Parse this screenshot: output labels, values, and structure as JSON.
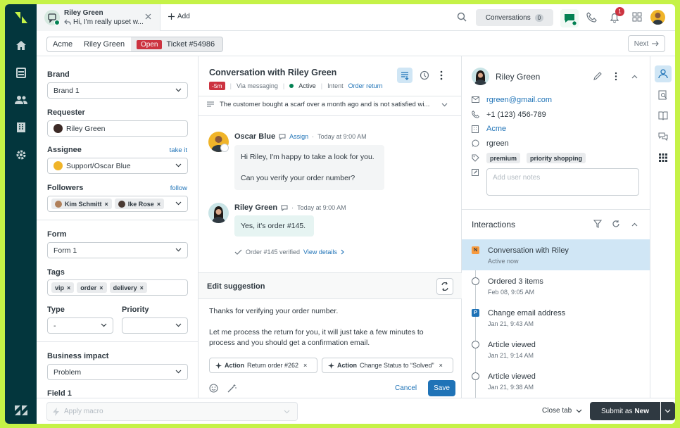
{
  "topbar": {
    "tab_user": "Riley Green",
    "tab_preview": "Hi, I'm really upset w...",
    "add_label": "Add",
    "conversations_label": "Conversations",
    "conversations_count": "0",
    "notification_count": "1"
  },
  "breadcrumb": {
    "org": "Acme",
    "requester": "Riley Green",
    "status": "Open",
    "ticket": "Ticket #54986",
    "next_label": "Next"
  },
  "left": {
    "brand_label": "Brand",
    "brand_value": "Brand 1",
    "requester_label": "Requester",
    "requester_value": "Riley Green",
    "assignee_label": "Assignee",
    "assignee_link": "take it",
    "assignee_value": "Support/Oscar Blue",
    "followers_label": "Followers",
    "followers_link": "follow",
    "followers": [
      "Kim Schmitt",
      "Ike Rose"
    ],
    "form_label": "Form",
    "form_value": "Form 1",
    "tags_label": "Tags",
    "tags": [
      "vip",
      "order",
      "delivery"
    ],
    "type_label": "Type",
    "type_value": "-",
    "priority_label": "Priority",
    "impact_label": "Business impact",
    "impact_value": "Problem",
    "field1_label": "Field 1"
  },
  "conversation": {
    "title": "Conversation with Riley Green",
    "age_badge": "-5m",
    "channel": "Via messaging",
    "status": "Active",
    "intent_label": "Intent",
    "intent_value": "Order return",
    "summary": "The customer bought a scarf over a month ago and is not satisfied wi...",
    "msg1_author": "Oscar Blue",
    "msg1_assign": "Assign",
    "msg1_time": "Today at 9:00 AM",
    "msg1_line1": "Hi Riley, I'm happy to take a look for you.",
    "msg1_line2": "Can you verify your order number?",
    "msg2_author": "Riley Green",
    "msg2_time": "Today at 9:00 AM",
    "msg2_text": "Yes, it's order #145.",
    "verify_text": "Order #145 verified",
    "verify_link": "View details"
  },
  "composer": {
    "title": "Edit suggestion",
    "line1": "Thanks for verifying your order number.",
    "line2": "Let me process the return for you, it will just take a few minutes to",
    "line3": "process and you should get a confirmation email.",
    "action_label": "Action",
    "action1": "Return order #262",
    "action2": "Change Status to “Solved”",
    "cancel": "Cancel",
    "save": "Save"
  },
  "user": {
    "name": "Riley Green",
    "email": "rgreen@gmail.com",
    "phone": "+1 (123) 456-789",
    "org": "Acme",
    "handle": "rgreen",
    "tags": [
      "premium",
      "priority shopping"
    ],
    "notes_placeholder": "Add user notes"
  },
  "interactions": {
    "title": "Interactions",
    "items": [
      {
        "badge": "N",
        "title": "Conversation with Riley",
        "sub": "Active now"
      },
      {
        "badge": "",
        "title": "Ordered 3 items",
        "sub": "Feb 08, 9:05 AM"
      },
      {
        "badge": "P",
        "title": "Change email address",
        "sub": "Jan 21, 9:43 AM"
      },
      {
        "badge": "",
        "title": "Article viewed",
        "sub": "Jan 21, 9:14 AM"
      },
      {
        "badge": "",
        "title": "Article viewed",
        "sub": "Jan 21, 9:38 AM"
      }
    ]
  },
  "bottom": {
    "macro_placeholder": "Apply macro",
    "close_tab": "Close tab",
    "submit_prefix": "Submit as",
    "submit_status": "New"
  },
  "colors": {
    "nav": "#03363d",
    "accent": "#1f73b7",
    "open_badge": "#cc3340",
    "active": "#038153",
    "highlight": "#d0e6f5",
    "page_border": "#c5f247"
  }
}
